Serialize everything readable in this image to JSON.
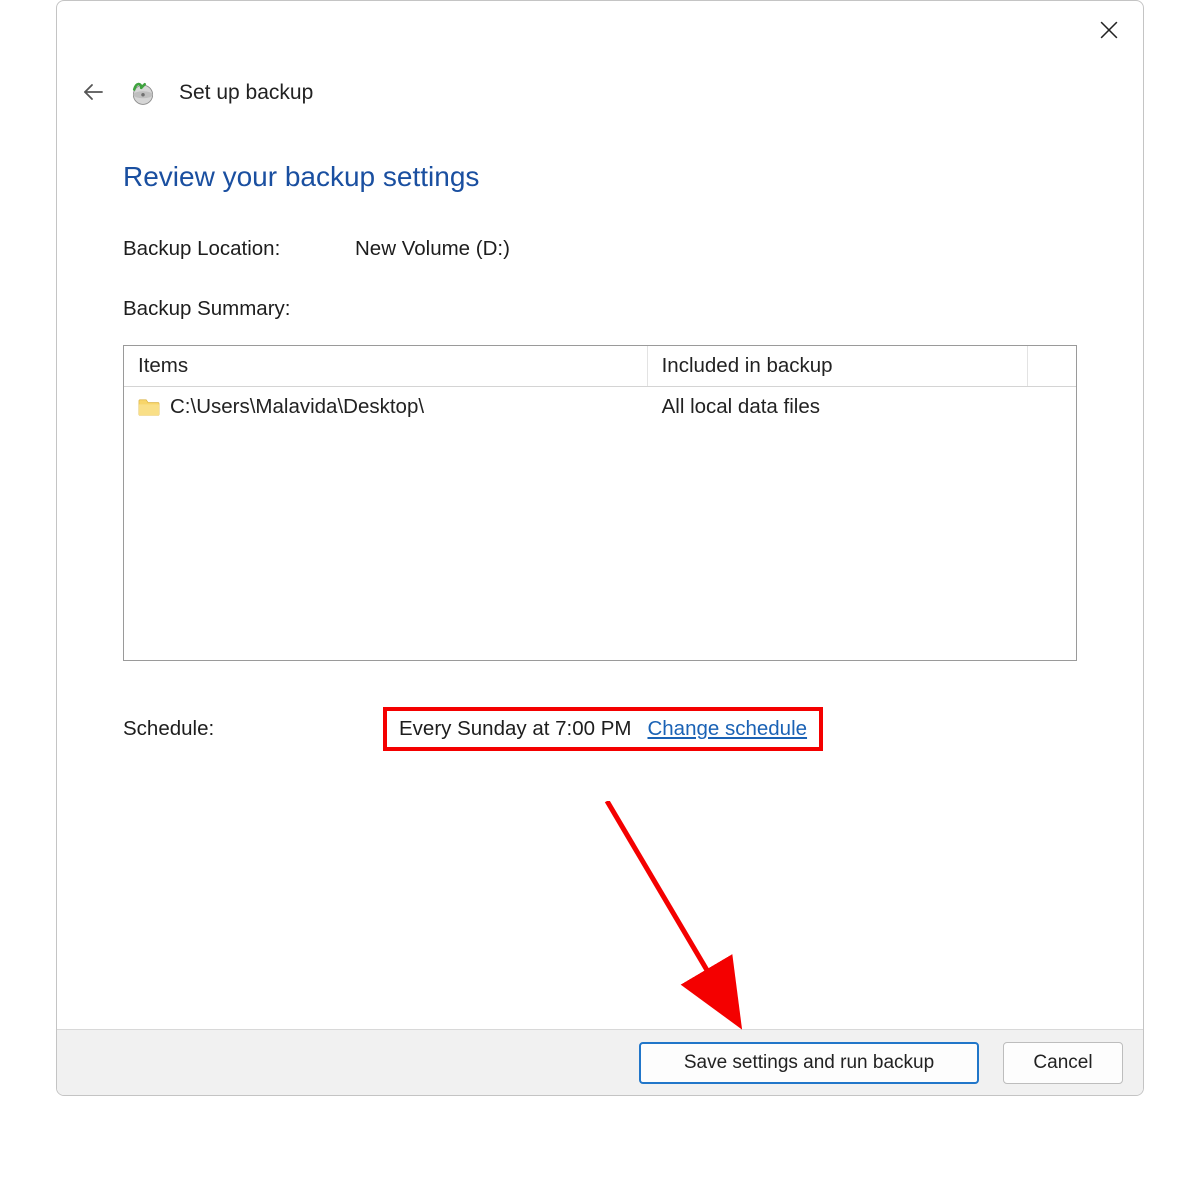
{
  "window": {
    "title": "Set up backup"
  },
  "content": {
    "heading": "Review your backup settings",
    "location_label": "Backup Location:",
    "location_value": "New Volume (D:)",
    "summary_label": "Backup Summary:",
    "table": {
      "col_items": "Items",
      "col_included": "Included in backup",
      "rows": [
        {
          "path": "C:\\Users\\Malavida\\Desktop\\",
          "included": "All local data files"
        }
      ]
    },
    "schedule_label": "Schedule:",
    "schedule_value": "Every Sunday at 7:00 PM",
    "change_schedule": "Change schedule"
  },
  "footer": {
    "primary": "Save settings and run backup",
    "cancel": "Cancel"
  },
  "icons": {
    "close": "close-icon",
    "back": "back-arrow-icon",
    "app": "backup-wizard-icon",
    "folder": "folder-icon"
  },
  "annotation": {
    "highlight": "schedule-highlight",
    "arrow": "pointer-arrow"
  }
}
